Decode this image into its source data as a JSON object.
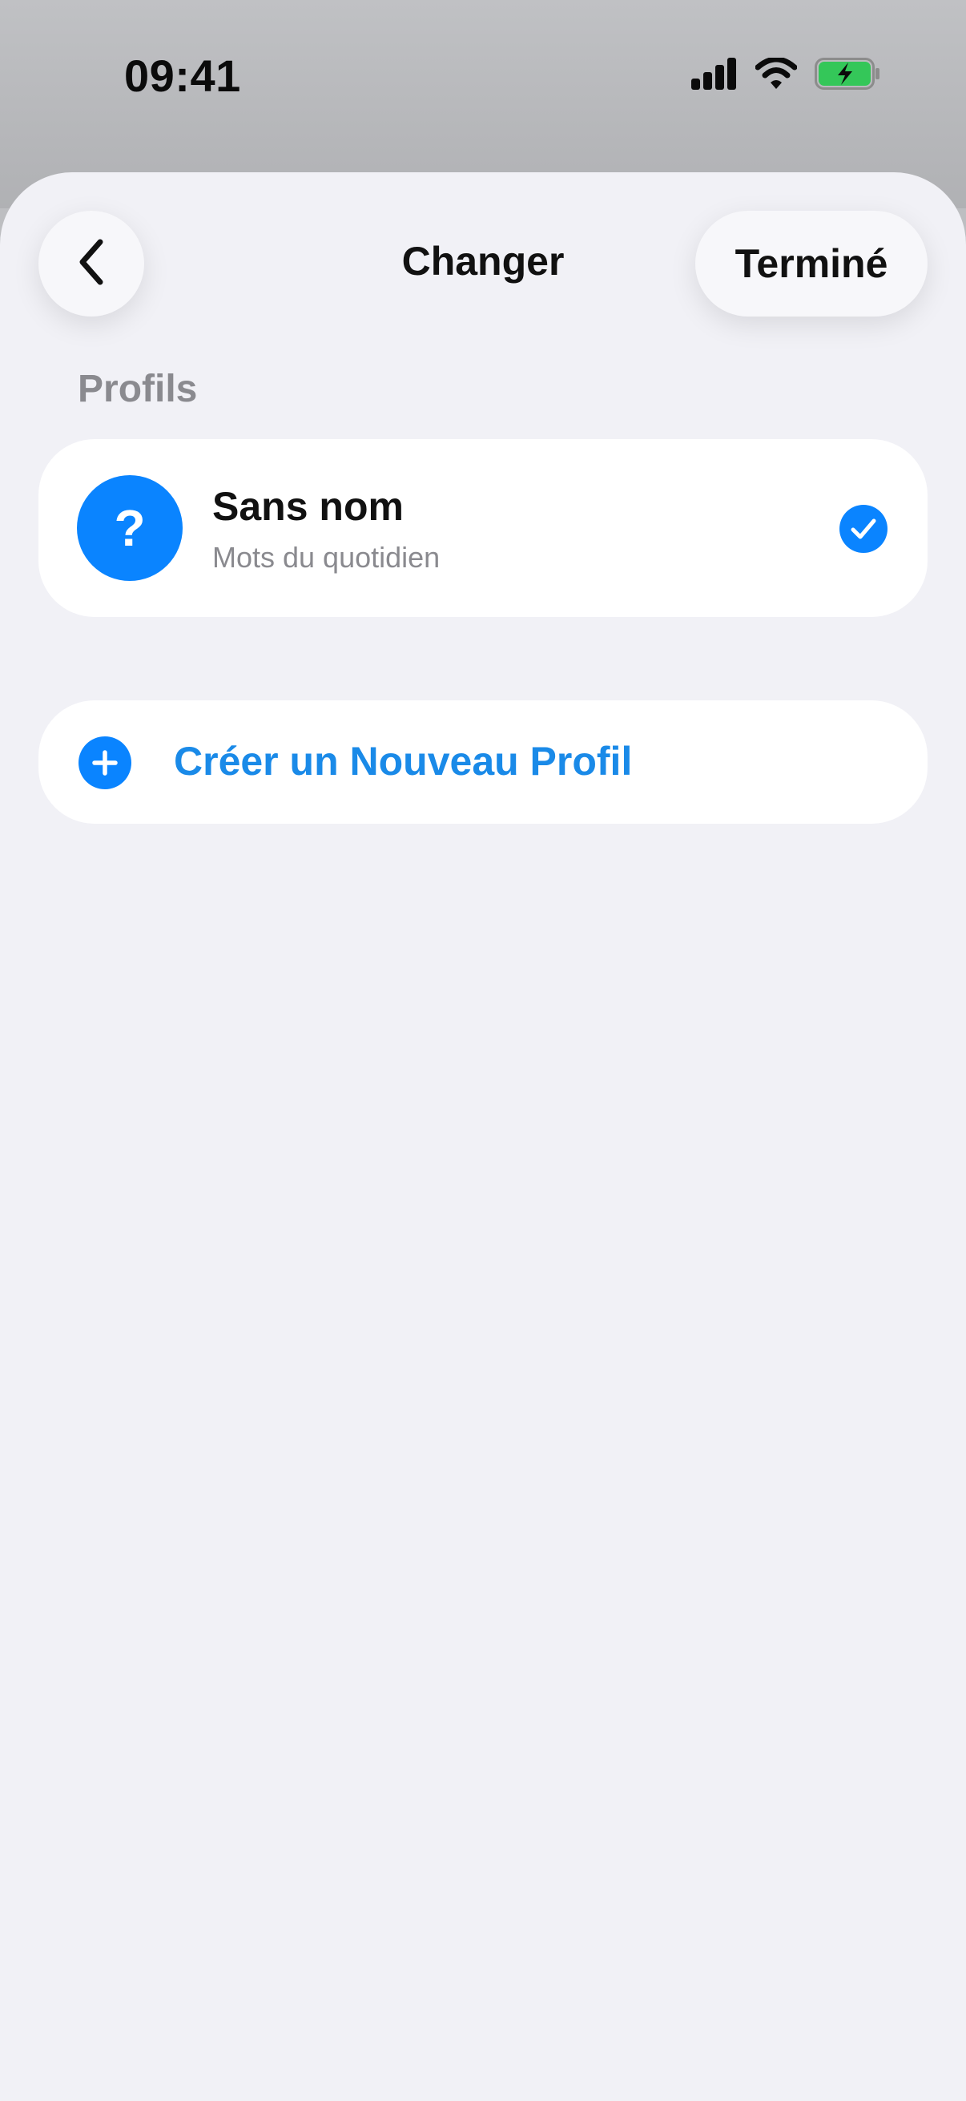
{
  "status_bar": {
    "time": "09:41",
    "icons": [
      "cellular-signal-icon",
      "wifi-icon",
      "battery-charging-icon"
    ],
    "battery_color": "#34c759"
  },
  "nav": {
    "back_icon": "chevron-left-icon",
    "title": "Changer",
    "done_label": "Terminé"
  },
  "section": {
    "label": "Profils"
  },
  "profiles": [
    {
      "avatar_glyph": "?",
      "name": "Sans nom",
      "subtitle": "Mots du quotidien",
      "selected": true
    }
  ],
  "create": {
    "icon": "plus-circle-icon",
    "label": "Créer un Nouveau Profil"
  },
  "colors": {
    "accent": "#0a84ff",
    "link": "#1a8ae8",
    "sheet_background": "#f1f1f6",
    "secondary_text": "#8a8a8f"
  }
}
